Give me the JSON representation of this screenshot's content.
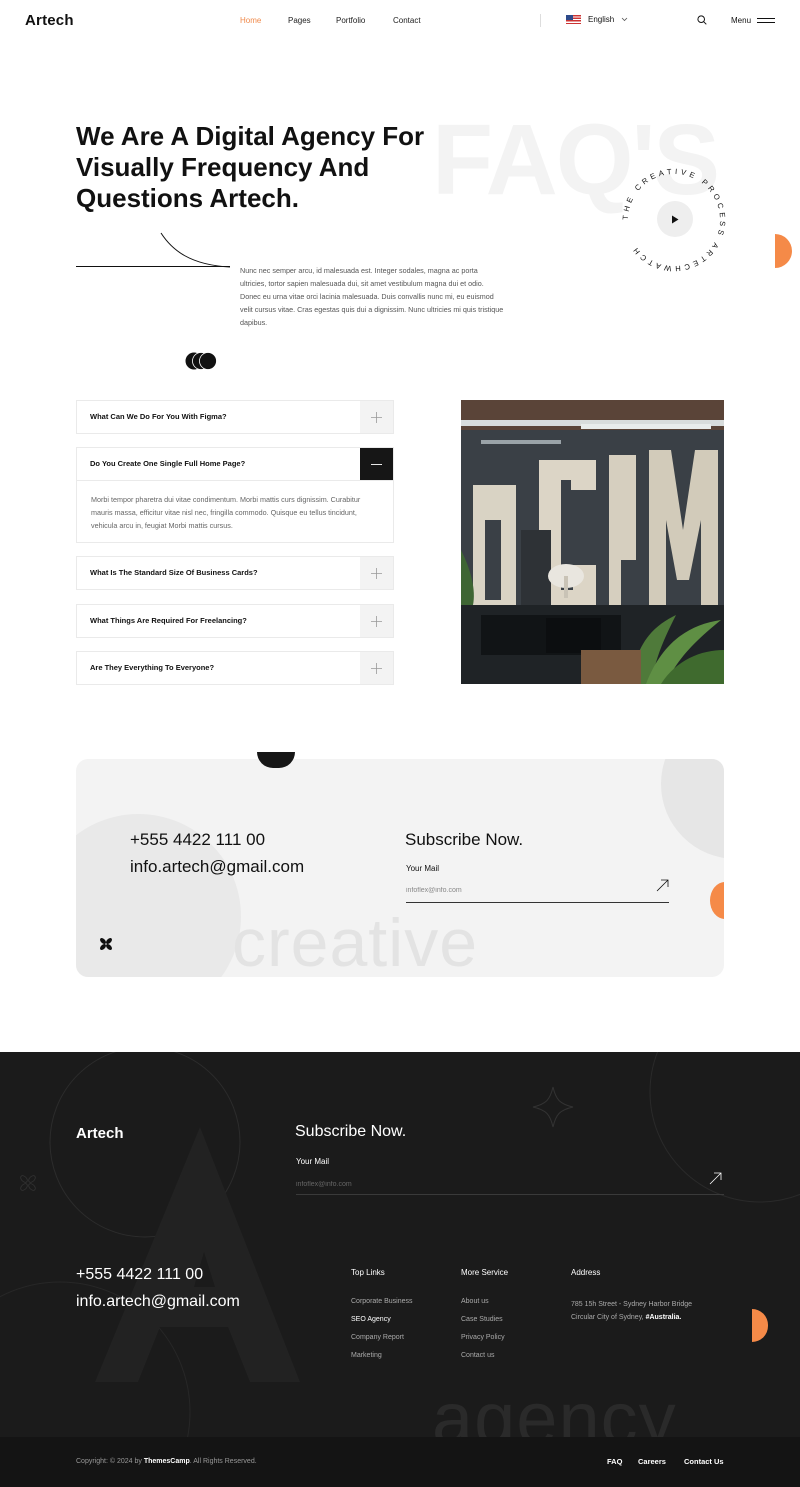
{
  "nav": {
    "logo": "Artech",
    "links": [
      "Home",
      "Pages",
      "Portfolio",
      "Contact"
    ],
    "active_link": "Home",
    "language": "English",
    "menu_label": "Menu"
  },
  "hero": {
    "bg_word": "FAQ'S",
    "title": "We Are A Digital Agency For Visually Frequency And Questions  Artech.",
    "text": "Nunc nec semper arcu, id malesuada est. Integer sodales, magna ac porta ultricies, tortor sapien malesuada dui, sit amet vestibulum magna dui et odio. Donec eu urna vitae orci lacinia malesuada. Duis convallis nunc mi, eu euismod velit cursus vitae. Cras egestas quis dui a dignissim. Nunc ultricies mi quis tristique dapibus.",
    "circle_text": "THE CREATIVE PROCESS ARTECHWATCH"
  },
  "faq": [
    {
      "question": "What Can We Do For You With Figma?",
      "open": false
    },
    {
      "question": "Do You Create One Single Full Home Page?",
      "open": true,
      "answer": "Morbi tempor pharetra dui vitae condimentum. Morbi mattis curs dignissim. Curabitur mauris massa, efficitur vitae nisl nec, fringilla commodo. Quisque eu tellus tincidunt, vehicula arcu in, feugiat Morbi mattis cursus."
    },
    {
      "question": "What Is The Standard Size Of Business Cards?",
      "open": false
    },
    {
      "question": "What Things Are Required For Freelancing?",
      "open": false
    },
    {
      "question": "Are They Everything To Everyone?",
      "open": false
    }
  ],
  "contact_card": {
    "phone": "+555 4422 111 00",
    "email": "info.artech@gmail.com",
    "subscribe_title": "Subscribe Now.",
    "mail_label": "Your Mail",
    "mail_placeholder": "infoflex@info.com",
    "bg_word": "creative"
  },
  "footer": {
    "logo": "Artech",
    "subscribe_title": "Subscribe Now.",
    "mail_label": "Your Mail",
    "mail_placeholder": "infoflex@info.com",
    "phone": "+555 4422 111 00",
    "email": "info.artech@gmail.com",
    "top_links_title": "Top Links",
    "top_links": [
      "Corporate Business",
      "SEO Agency",
      "Company Report",
      "Marketing"
    ],
    "more_service_title": "More Service",
    "more_service": [
      "About us",
      "Case Studies",
      "Privacy Policy",
      "Contact us"
    ],
    "address_title": "Address",
    "address": "785 15h Street - Sydney Harbor Bridge Circular City of Sydney,",
    "address_country": "#Australia.",
    "bg_word": "agency",
    "copyright_prefix": "Copyright: © 2024 by",
    "copyright_brand": "ThemesCamp",
    "copyright_suffix": ". All Rights Reserved.",
    "bottom_links": [
      "FAQ",
      "Careers",
      "Contact Us"
    ]
  },
  "colors": {
    "accent": "#f58a48",
    "dark": "#1b1b1b",
    "card_bg": "#f3f3f3"
  },
  "icons": [
    "search-icon",
    "hamburger-icon",
    "chevron-down-icon",
    "play-icon",
    "plus-icon",
    "minus-icon",
    "send-arrow-icon",
    "flower-icon",
    "overlapping-circles-icon"
  ]
}
